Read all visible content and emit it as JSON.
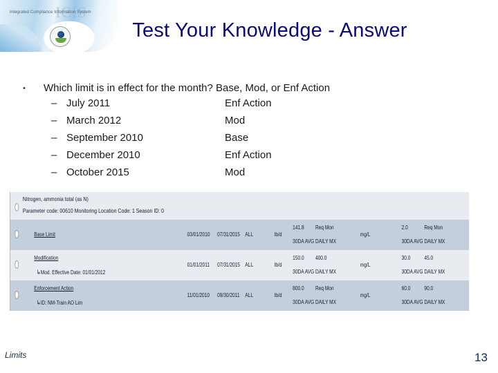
{
  "header": {
    "system_name": "Integrated Compliance Information System",
    "system_acronym": "ICIS",
    "logo": "epa-seal-icon"
  },
  "title": "Test Your Knowledge - Answer",
  "question": {
    "bullet": "•",
    "text": "Which limit is in effect for the month?   Base, Mod, or Enf Action",
    "dash": "–",
    "items": [
      {
        "month": "July 2011",
        "answer": "Enf Action"
      },
      {
        "month": "March 2012",
        "answer": "Mod"
      },
      {
        "month": "September 2010",
        "answer": "Base"
      },
      {
        "month": "December 2010",
        "answer": "Enf Action"
      },
      {
        "month": "October 2015",
        "answer": "Mod"
      }
    ]
  },
  "limits_table": {
    "parameter_name": "Nitrogen, ammonia total (as N)",
    "parameter_info": "Parameter code: 00610 Monitoring Location Code: 1 Season ID: 0",
    "rows": [
      {
        "limit_type": "Base Limit",
        "sub_text": "",
        "start": "03/01/2010",
        "end": "07/31/2015",
        "season": "ALL",
        "qty_unit": "lb/d",
        "qty1_value": "141.8",
        "qty1_stat": "30DA AVG",
        "qty2_value": "Req Mon",
        "qty2_stat": "DAILY MX",
        "conc_unit": "mg/L",
        "conc1_value": "2.0",
        "conc1_stat": "30DA AVG",
        "conc2_value": "Req Mon",
        "conc2_stat": "DAILY MX"
      },
      {
        "limit_type": "Modification",
        "sub_text": "Mod. Effective Date: 01/01/2012",
        "start": "01/01/2011",
        "end": "07/31/2015",
        "season": "ALL",
        "qty_unit": "lb/d",
        "qty1_value": "150.0",
        "qty1_stat": "30DA AVG",
        "qty2_value": "400.0",
        "qty2_stat": "DAILY MX",
        "conc_unit": "mg/L",
        "conc1_value": "30.0",
        "conc1_stat": "30DA AVG",
        "conc2_value": "45.0",
        "conc2_stat": "DAILY MX"
      },
      {
        "limit_type": "Enforcement Action",
        "sub_text": "ID: NM-Train AO Lim",
        "start": "11/01/2010",
        "end": "09/30/2011",
        "season": "ALL",
        "qty_unit": "lb/d",
        "qty1_value": "800.0",
        "qty1_stat": "30DA AVG",
        "qty2_value": "Req Mon",
        "qty2_stat": "DAILY MX",
        "conc_unit": "mg/L",
        "conc1_value": "60.0",
        "conc1_stat": "30DA AVG",
        "conc2_value": "90.0",
        "conc2_stat": "DAILY MX"
      }
    ]
  },
  "footer": {
    "label": "Limits",
    "page_number": "13"
  },
  "colors": {
    "title": "#0a0a7a",
    "row_dark": "#c3cfdc",
    "row_light": "#e8ecf0"
  }
}
